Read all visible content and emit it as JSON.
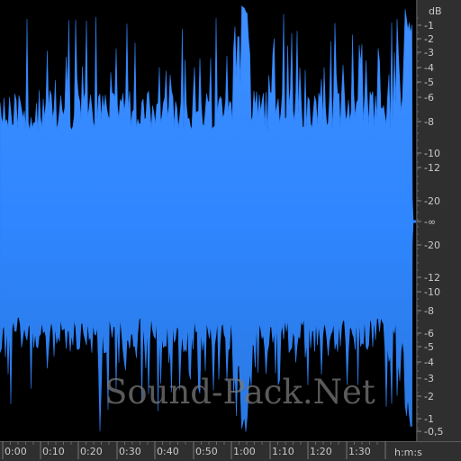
{
  "app": {
    "name": "audio-waveform-view"
  },
  "db_ruler": {
    "unit": "dB",
    "top_labels": [
      "-1",
      "-2",
      "-3",
      "-4",
      "-5",
      "-6",
      "-8",
      "-10",
      "-12",
      "-20"
    ],
    "center_label": "-∞",
    "bottom_labels": [
      "-20",
      "-12",
      "-10",
      "-8",
      "-6",
      "-5",
      "-4",
      "-3",
      "-2",
      "-1",
      "-0,5"
    ]
  },
  "time_ruler": {
    "labels": [
      "0:00",
      "0:10",
      "0:20",
      "0:30",
      "0:40",
      "0:50",
      "1:00",
      "1:10",
      "1:20",
      "1:30"
    ],
    "unit": "h:m:s"
  },
  "watermark": {
    "text": "Sound-Pack.Net"
  },
  "colors": {
    "waveform_light": "#3f8fff",
    "waveform_mid": "#2f86ff",
    "waveform_dark": "#2a78e0",
    "background": "#000000",
    "ruler_background": "#2f2f2f",
    "ruler_text": "#c9c9c9"
  }
}
